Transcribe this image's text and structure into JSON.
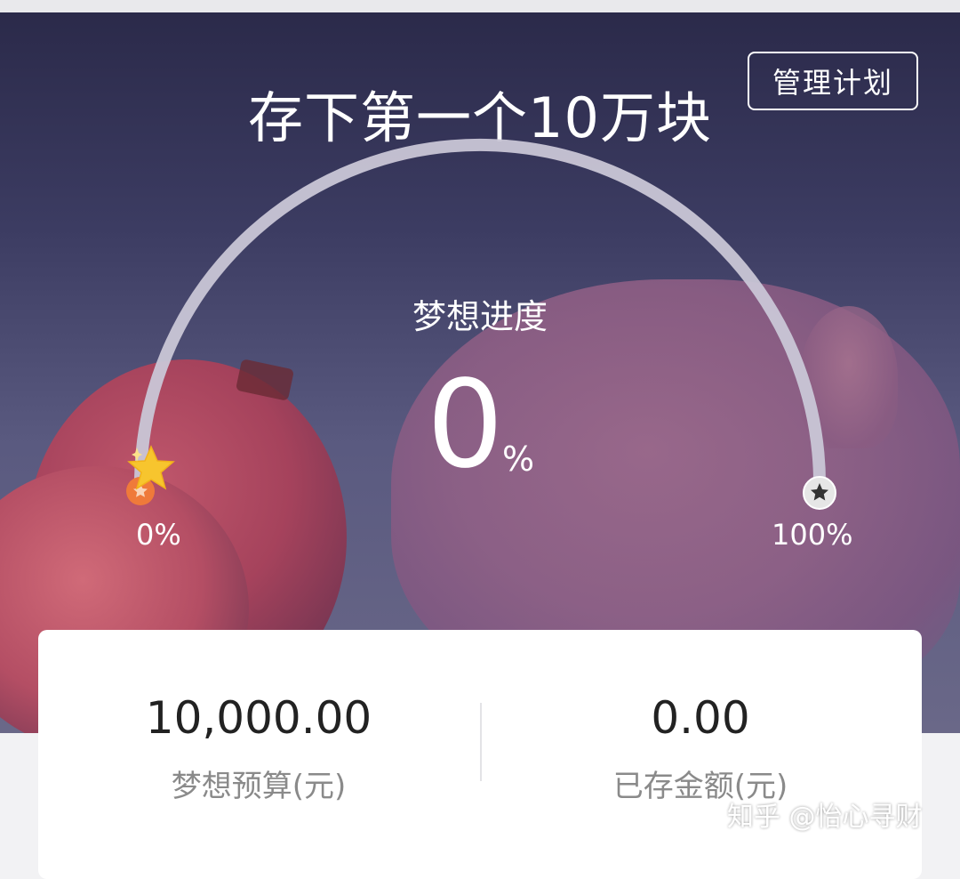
{
  "plan": {
    "title": "存下第一个10万块",
    "manage_button": "管理计划"
  },
  "progress": {
    "label": "梦想进度",
    "value": "0",
    "unit": "%",
    "percent": 0,
    "start_label": "0%",
    "end_label": "100%"
  },
  "stats": {
    "budget_value": "10,000.00",
    "budget_label": "梦想预算(元)",
    "saved_value": "0.00",
    "saved_label": "已存金额(元)"
  },
  "watermark": "知乎 @怡心寻财",
  "colors": {
    "star": "#f7c52e",
    "start_marker": "#ef7a3a",
    "arc": "#c9c6d6",
    "end_marker": "#e6e6e6"
  }
}
